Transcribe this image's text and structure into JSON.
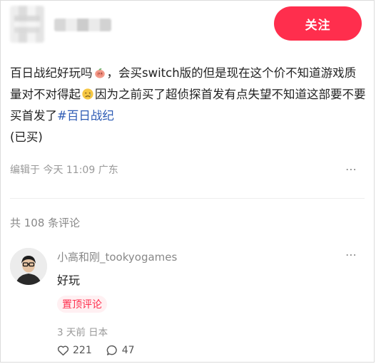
{
  "header": {
    "follow_label": "关注"
  },
  "post": {
    "text_part1": "百日战纪好玩吗",
    "text_part2": "，会买switch版的但是现在这个价不知道游戏质量对不对得起",
    "text_part3": "因为之前买了超侦探首发有点失望不知道这部要不要买首发了",
    "tag": "#百日战纪",
    "line2": "(已买)",
    "meta": "编辑于 今天 11:09 广东",
    "more_icon": "⋯"
  },
  "comments_header": {
    "label": "共 108 条评论"
  },
  "comment": {
    "username": "小高和刚_tookyogames",
    "text": "好玩",
    "pinned_label": "置顶评论",
    "meta": "3 天前 日本",
    "likes": "221",
    "replies": "47",
    "more_icon": "⋯"
  },
  "colors": {
    "accent": "#ff2e4d",
    "hashtag": "#2d5bb4"
  }
}
